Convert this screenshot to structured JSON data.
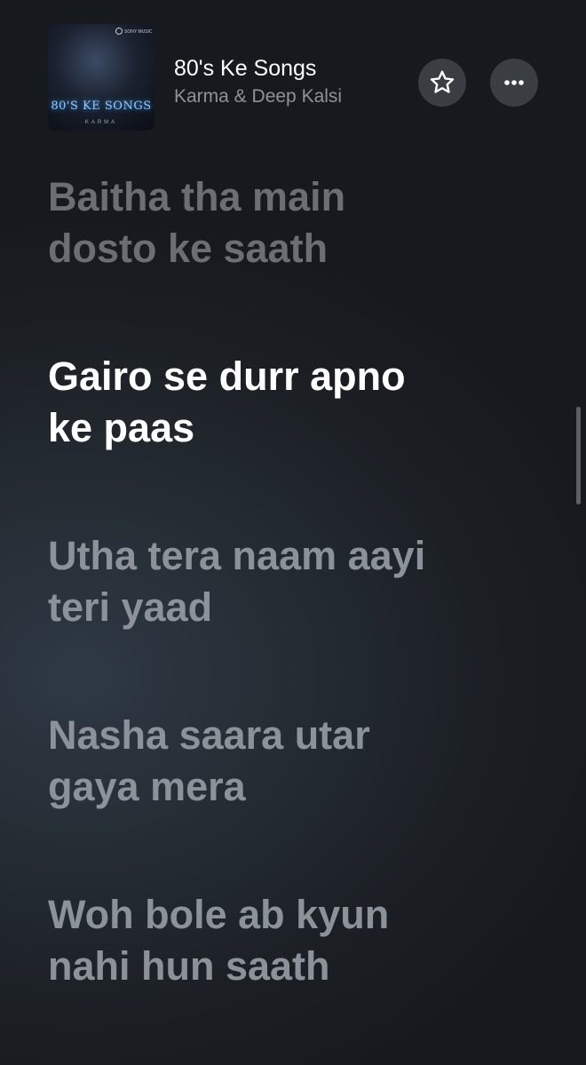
{
  "now_playing": {
    "title": "80's Ke Songs",
    "artist": "Karma & Deep Kalsi",
    "artwork": {
      "title_text": "80'S KE SONGS",
      "artist_text": "KARMA",
      "label_text": "SONY MUSIC"
    }
  },
  "actions": {
    "favorite_icon": "star-icon",
    "more_icon": "ellipsis-icon"
  },
  "lyrics": [
    {
      "state": "past",
      "lines": [
        "Baitha tha main",
        "dosto ke saath"
      ]
    },
    {
      "state": "active",
      "lines": [
        "Gairo se durr apno",
        "ke paas"
      ]
    },
    {
      "state": "upcoming",
      "lines": [
        "Utha tera naam aayi",
        "teri yaad"
      ]
    },
    {
      "state": "upcoming",
      "lines": [
        "Nasha saara utar",
        "gaya mera"
      ]
    },
    {
      "state": "upcoming",
      "lines": [
        "Woh bole ab kyun",
        "nahi hun saath"
      ]
    }
  ],
  "colors": {
    "active_lyric": "#ffffff",
    "inactive_lyric": "#8c9299",
    "secondary_text": "#8e9399",
    "button_bg": "#3a3d42"
  }
}
